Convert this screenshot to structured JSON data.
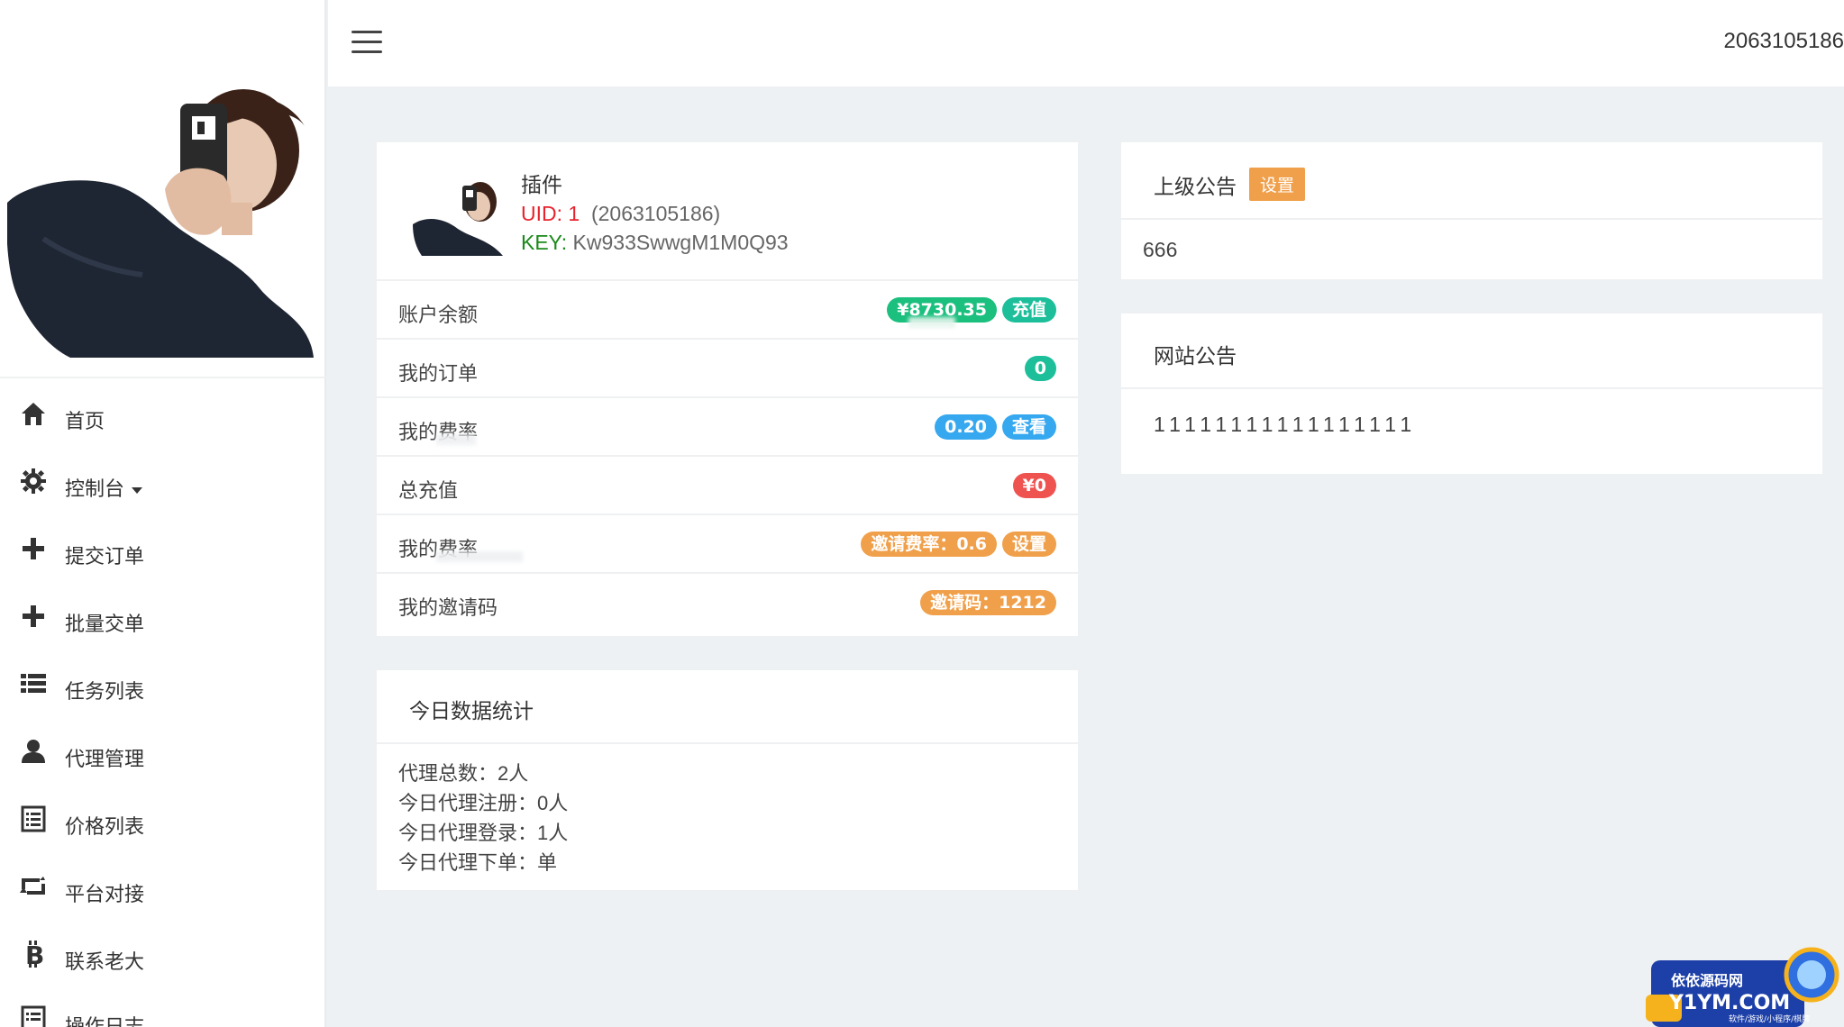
{
  "topbar": {
    "user": "2063105186"
  },
  "sidebar": {
    "items": [
      {
        "label": "首页",
        "icon": "home-icon"
      },
      {
        "label": "控制台",
        "icon": "gear-icon",
        "has_caret": true
      },
      {
        "label": "提交订单",
        "icon": "plus-icon"
      },
      {
        "label": "批量交单",
        "icon": "plus-icon"
      },
      {
        "label": "任务列表",
        "icon": "list-icon"
      },
      {
        "label": "代理管理",
        "icon": "user-icon"
      },
      {
        "label": "价格列表",
        "icon": "document-list-icon"
      },
      {
        "label": "平台对接",
        "icon": "retweet-icon"
      },
      {
        "label": "联系老大",
        "icon": "bitcoin-icon"
      },
      {
        "label": "操作日志",
        "icon": "document-list-icon"
      }
    ]
  },
  "user_panel": {
    "title": "插件",
    "uid_label": "UID: 1",
    "uid_qq": "(2063105186)",
    "key_label": "KEY:",
    "key_value": "Kw933SwwgM1M0Q93",
    "rows": [
      {
        "label": "账户余额",
        "badges": [
          {
            "text": "¥8730.35",
            "color": "#1bbf7e"
          },
          {
            "text": "充值",
            "color": "#1dbf9b"
          }
        ]
      },
      {
        "label": "我的订单",
        "badges": [
          {
            "text": "0",
            "color": "#1dbf9b"
          }
        ]
      },
      {
        "label": "我的费率",
        "badges": [
          {
            "text": "0.20",
            "color": "#36a8ef"
          },
          {
            "text": "查看",
            "color": "#36a8ef"
          }
        ]
      },
      {
        "label": "总充值",
        "badges": [
          {
            "text": "¥0",
            "color": "#ef5350"
          }
        ]
      },
      {
        "label": "我的费率",
        "badges": [
          {
            "text": "邀请费率：0.6",
            "color": "#f0a04b"
          },
          {
            "text": "设置",
            "color": "#f0a04b"
          }
        ]
      },
      {
        "label": "我的邀请码",
        "badges": [
          {
            "text": "邀请码：1212",
            "color": "#f0a04b"
          }
        ]
      }
    ]
  },
  "today_panel": {
    "title": "今日数据统计",
    "lines": [
      "代理总数：2人",
      "今日代理注册：0人",
      "今日代理登录：1人",
      "今日代理下单：单"
    ]
  },
  "notice_panel": {
    "title": "上级公告",
    "button": "设置",
    "body": "666"
  },
  "site_panel": {
    "title": "网站公告",
    "body": "11111111111111111"
  },
  "watermark": {
    "line1": "依依源码网",
    "line2": "Y1YM.COM",
    "line3": "软件/游戏/小程序/棋牌"
  }
}
